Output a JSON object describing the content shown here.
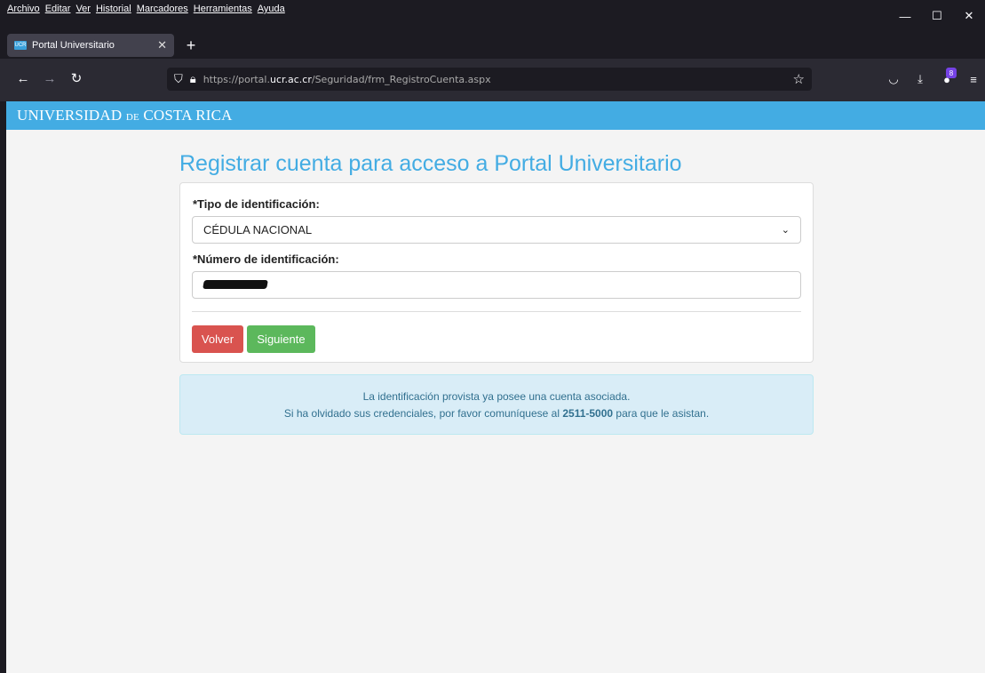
{
  "browser": {
    "menu": [
      "Archivo",
      "Editar",
      "Ver",
      "Historial",
      "Marcadores",
      "Herramientas",
      "Ayuda"
    ],
    "tab_title": "Portal Universitario",
    "favicon_text": "UCR",
    "url_prefix": "https://portal.",
    "url_domain": "ucr.ac.cr",
    "url_path": "/Seguridad/frm_RegistroCuenta.aspx",
    "extension_badge": "8"
  },
  "header": {
    "logo_part1": "UNIVERSIDAD",
    "logo_part2": "DE",
    "logo_part3": "COSTA RICA"
  },
  "form": {
    "title": "Registrar cuenta para acceso a Portal Universitario",
    "id_type_label": "*Tipo de identificación:",
    "id_type_value": "CÉDULA NACIONAL",
    "id_number_label": "*Número de identificación:",
    "back_button": "Volver",
    "next_button": "Siguiente"
  },
  "alert": {
    "line1": "La identificación provista ya posee una cuenta asociada.",
    "line2_before": "Si ha olvidado sus credenciales, por favor comuníquese al ",
    "phone": "2511-5000",
    "line2_after": " para que le asistan."
  }
}
